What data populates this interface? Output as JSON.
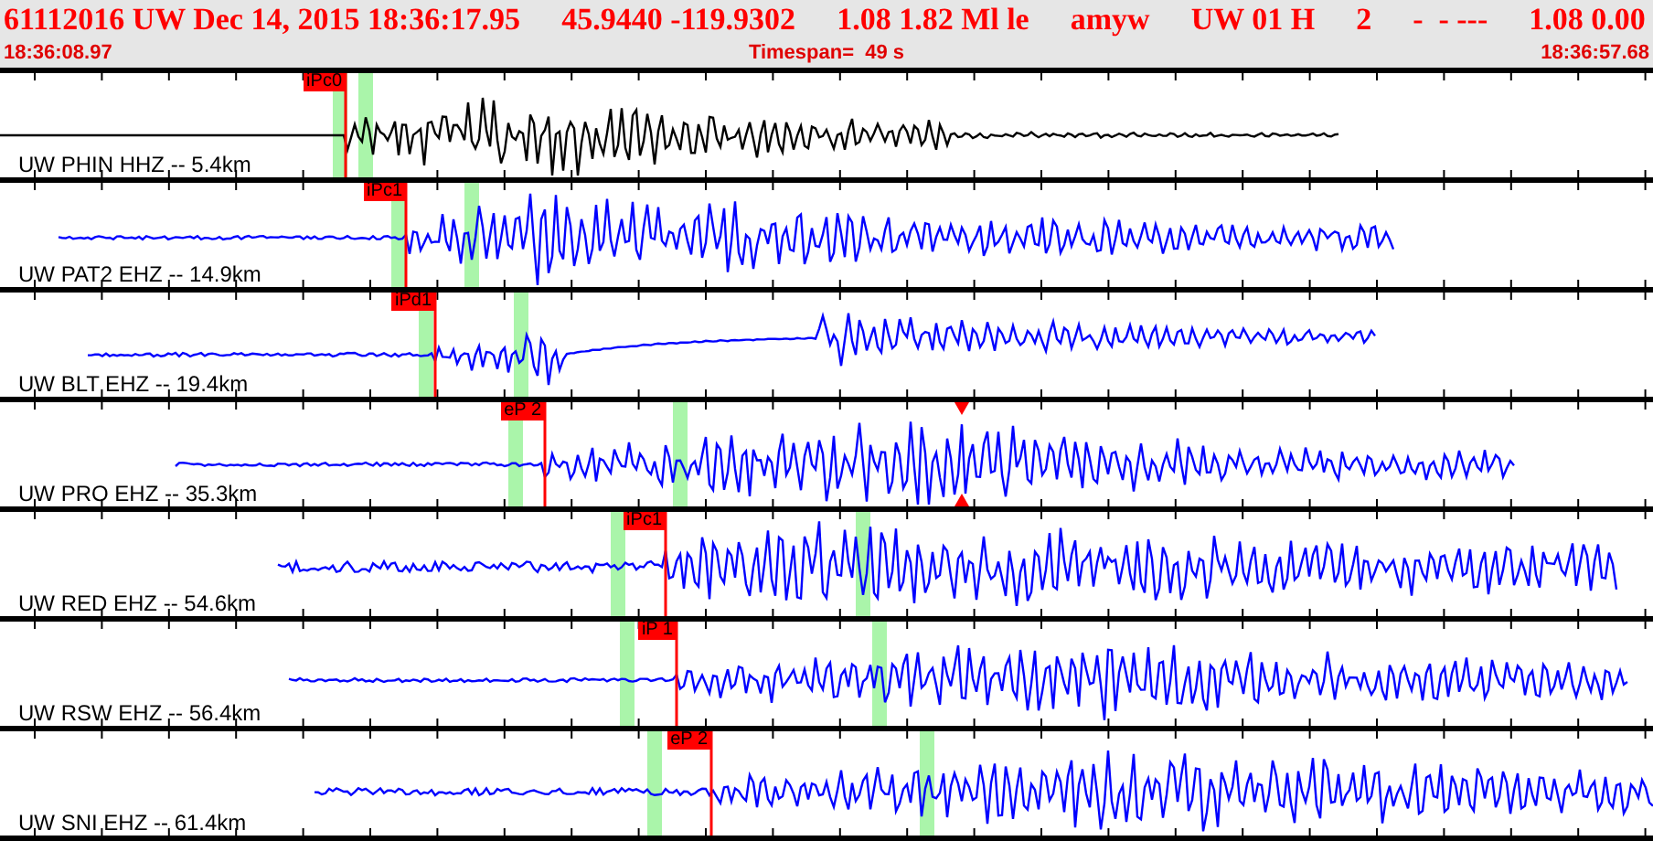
{
  "header": {
    "fields": [
      "61112016 UW Dec 14, 2015 18:36:17.95",
      "45.9440 -119.9302",
      "1.08 1.82 Ml le",
      "amyw",
      "UW 01 H",
      "2",
      "-  - ---",
      "1.08 0.00"
    ],
    "start_time": "18:36:08.97",
    "timespan": "Timespan=  49 s",
    "end_time": "18:36:57.68"
  },
  "traces": [
    {
      "label": "UW PHIN HHZ -- 5.4km",
      "pick": "iPc0",
      "color": "#000000",
      "peak_marker": false
    },
    {
      "label": "UW PAT2 EHZ -- 14.9km",
      "pick": "iPc1",
      "color": "#0000ff",
      "peak_marker": false
    },
    {
      "label": "UW BLT EHZ -- 19.4km",
      "pick": "iPd1",
      "color": "#0000ff",
      "peak_marker": false
    },
    {
      "label": "UW PRO EHZ -- 35.3km",
      "pick": "eP 2",
      "color": "#0000ff",
      "peak_marker": true
    },
    {
      "label": "UW RED EHZ -- 54.6km",
      "pick": "iPc1",
      "color": "#0000ff",
      "peak_marker": false
    },
    {
      "label": "UW RSW EHZ -- 56.4km",
      "pick": "iP 1",
      "color": "#0000ff",
      "peak_marker": false
    },
    {
      "label": "UW SNI EHZ -- 61.4km",
      "pick": "eP 2",
      "color": "#0000ff",
      "peak_marker": false
    }
  ]
}
